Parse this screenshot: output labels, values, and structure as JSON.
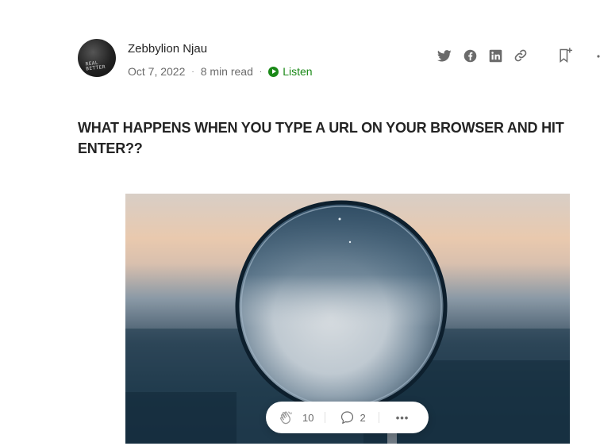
{
  "author": {
    "name": "Zebbylion Njau",
    "avatar_text": "REAL BETTER"
  },
  "meta": {
    "date": "Oct 7, 2022",
    "read_time": "8 min read",
    "separator": "·",
    "listen_label": "Listen"
  },
  "share_icons": [
    "twitter-icon",
    "facebook-icon",
    "linkedin-icon",
    "link-icon",
    "bookmark-add-icon"
  ],
  "article": {
    "title": "WHAT HAPPENS WHEN YOU TYPE A URL ON YOUR BROWSER AND HIT ENTER??"
  },
  "hero_image": {
    "subject": "magnifying glass"
  },
  "engagement": {
    "claps": "10",
    "responses": "2",
    "more": "•••"
  },
  "colors": {
    "accent_green": "#1a8917",
    "text_primary": "#242424",
    "text_secondary": "#6b6b6b",
    "icon_gray": "#6b6b6b"
  }
}
